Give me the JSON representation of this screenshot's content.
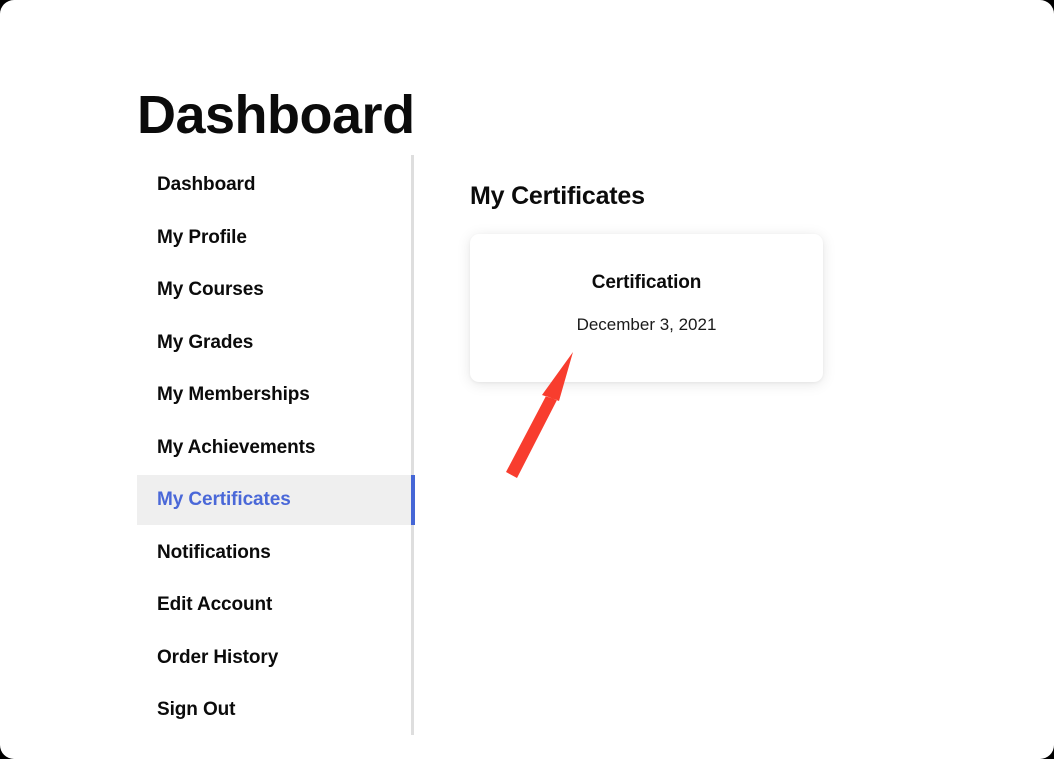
{
  "page": {
    "title": "Dashboard"
  },
  "sidebar": {
    "items": [
      {
        "label": "Dashboard",
        "name": "dashboard",
        "active": false
      },
      {
        "label": "My Profile",
        "name": "my-profile",
        "active": false
      },
      {
        "label": "My Courses",
        "name": "my-courses",
        "active": false
      },
      {
        "label": "My Grades",
        "name": "my-grades",
        "active": false
      },
      {
        "label": "My Memberships",
        "name": "my-memberships",
        "active": false
      },
      {
        "label": "My Achievements",
        "name": "my-achievements",
        "active": false
      },
      {
        "label": "My Certificates",
        "name": "my-certificates",
        "active": true
      },
      {
        "label": "Notifications",
        "name": "notifications",
        "active": false
      },
      {
        "label": "Edit Account",
        "name": "edit-account",
        "active": false
      },
      {
        "label": "Order History",
        "name": "order-history",
        "active": false
      },
      {
        "label": "Sign Out",
        "name": "sign-out",
        "active": false
      }
    ],
    "active_color": "#4a68d8",
    "active_background": "#efefef",
    "active_indicator_color": "#4566d6",
    "divider_color": "#dedede"
  },
  "main": {
    "heading": "My Certificates",
    "certificates": [
      {
        "title": "Certification",
        "date": "December 3, 2021"
      }
    ]
  },
  "annotation": {
    "type": "arrow",
    "color": "#f83d2e",
    "points_to": "certificate-card"
  }
}
